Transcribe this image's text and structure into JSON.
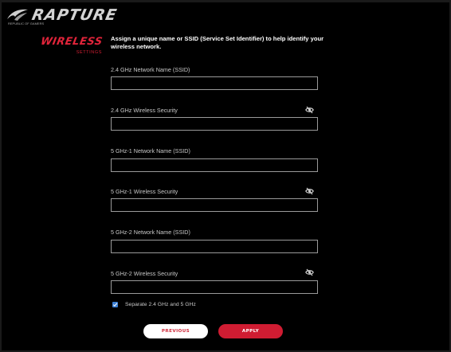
{
  "header": {
    "brand_name": "RAPTURE",
    "brand_sub": "REPUBLIC OF GAMERS",
    "logo_icon": "rog-eye-icon"
  },
  "section": {
    "title": "WIRELESS",
    "subtitle": "SETTINGS"
  },
  "intro": "Assign a unique name or SSID (Service Set Identifier) to help identify your wireless network.",
  "fields": [
    {
      "label": "2.4 GHz Network Name (SSID)",
      "value": "",
      "has_visibility_toggle": false
    },
    {
      "label": "2.4 GHz Wireless Security",
      "value": "",
      "has_visibility_toggle": true,
      "icon": "eye-slash-icon"
    },
    {
      "label": "5 GHz-1 Network Name (SSID)",
      "value": "",
      "has_visibility_toggle": false
    },
    {
      "label": "5 GHz-1 Wireless Security",
      "value": "",
      "has_visibility_toggle": true,
      "icon": "eye-slash-icon"
    },
    {
      "label": "5 GHz-2 Network Name (SSID)",
      "value": "",
      "has_visibility_toggle": false
    },
    {
      "label": "5 GHz-2 Wireless Security",
      "value": "",
      "has_visibility_toggle": true,
      "icon": "eye-slash-icon"
    }
  ],
  "separate_bands": {
    "label": "Separate 2.4 GHz and 5 GHz",
    "checked": true
  },
  "buttons": {
    "previous": "PREVIOUS",
    "apply": "APPLY"
  },
  "colors": {
    "accent_red": "#d01c32",
    "checkbox_blue": "#3b7fd4",
    "background": "#000000"
  }
}
